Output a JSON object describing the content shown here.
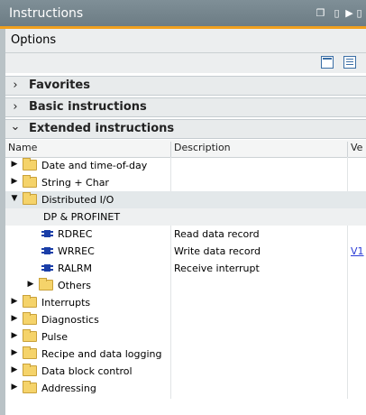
{
  "window": {
    "title": "Instructions"
  },
  "options": {
    "label": "Options"
  },
  "sections": [
    {
      "label": "Favorites",
      "expanded": false
    },
    {
      "label": "Basic instructions",
      "expanded": false
    },
    {
      "label": "Extended instructions",
      "expanded": true
    }
  ],
  "columns": {
    "name": "Name",
    "description": "Description",
    "version": "Ve"
  },
  "tree": [
    {
      "type": "folder",
      "label": "Date and time-of-day",
      "expander": "right"
    },
    {
      "type": "folder",
      "label": "String + Char",
      "expander": "right"
    },
    {
      "type": "folder",
      "label": "Distributed I/O",
      "expander": "down",
      "selected": true
    },
    {
      "type": "group",
      "label": "DP & PROFINET"
    },
    {
      "type": "instruction",
      "label": "RDREC",
      "description": "Read data record"
    },
    {
      "type": "instruction",
      "label": "WRREC",
      "description": "Write data record",
      "version": "V1"
    },
    {
      "type": "instruction",
      "label": "RALRM",
      "description": "Receive interrupt"
    },
    {
      "type": "subfolder",
      "label": "Others",
      "expander": "right"
    },
    {
      "type": "folder",
      "label": "Interrupts",
      "expander": "right"
    },
    {
      "type": "folder",
      "label": "Diagnostics",
      "expander": "right"
    },
    {
      "type": "folder",
      "label": "Pulse",
      "expander": "right"
    },
    {
      "type": "folder",
      "label": "Recipe and data logging",
      "expander": "right"
    },
    {
      "type": "folder",
      "label": "Data block control",
      "expander": "right"
    },
    {
      "type": "folder",
      "label": "Addressing",
      "expander": "right"
    }
  ],
  "icons": {
    "expander_right": "▶",
    "expander_down": "▼",
    "section_collapsed": "›",
    "section_expanded": "⌄"
  },
  "colors": {
    "accent": "#f0a01e",
    "titlebar": "#75858d",
    "link": "#2a3bd6"
  }
}
